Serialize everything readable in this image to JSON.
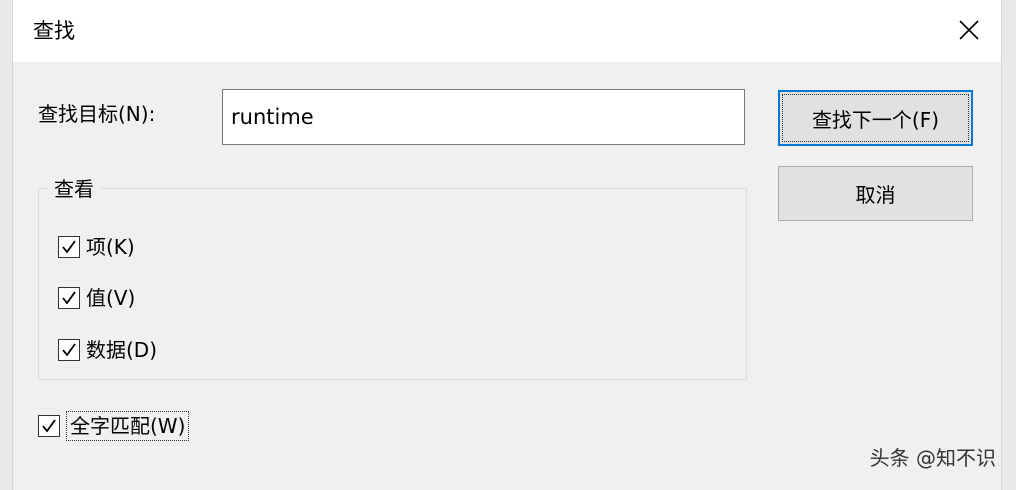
{
  "dialog": {
    "title": "查找",
    "close_label": "close"
  },
  "find": {
    "label": "查找目标(N):",
    "value": "runtime"
  },
  "buttons": {
    "find_next": "查找下一个(F)",
    "cancel": "取消"
  },
  "look_at": {
    "title": "查看",
    "options": [
      {
        "label": "项(K)",
        "checked": true
      },
      {
        "label": "值(V)",
        "checked": true
      },
      {
        "label": "数据(D)",
        "checked": true
      }
    ]
  },
  "match_whole": {
    "label": "全字匹配(W)",
    "checked": true
  },
  "watermark": "头条 @知不识",
  "icons": {
    "close": "close-icon",
    "check": "checkmark-icon"
  },
  "colors": {
    "focus_border": "#0078d7"
  }
}
